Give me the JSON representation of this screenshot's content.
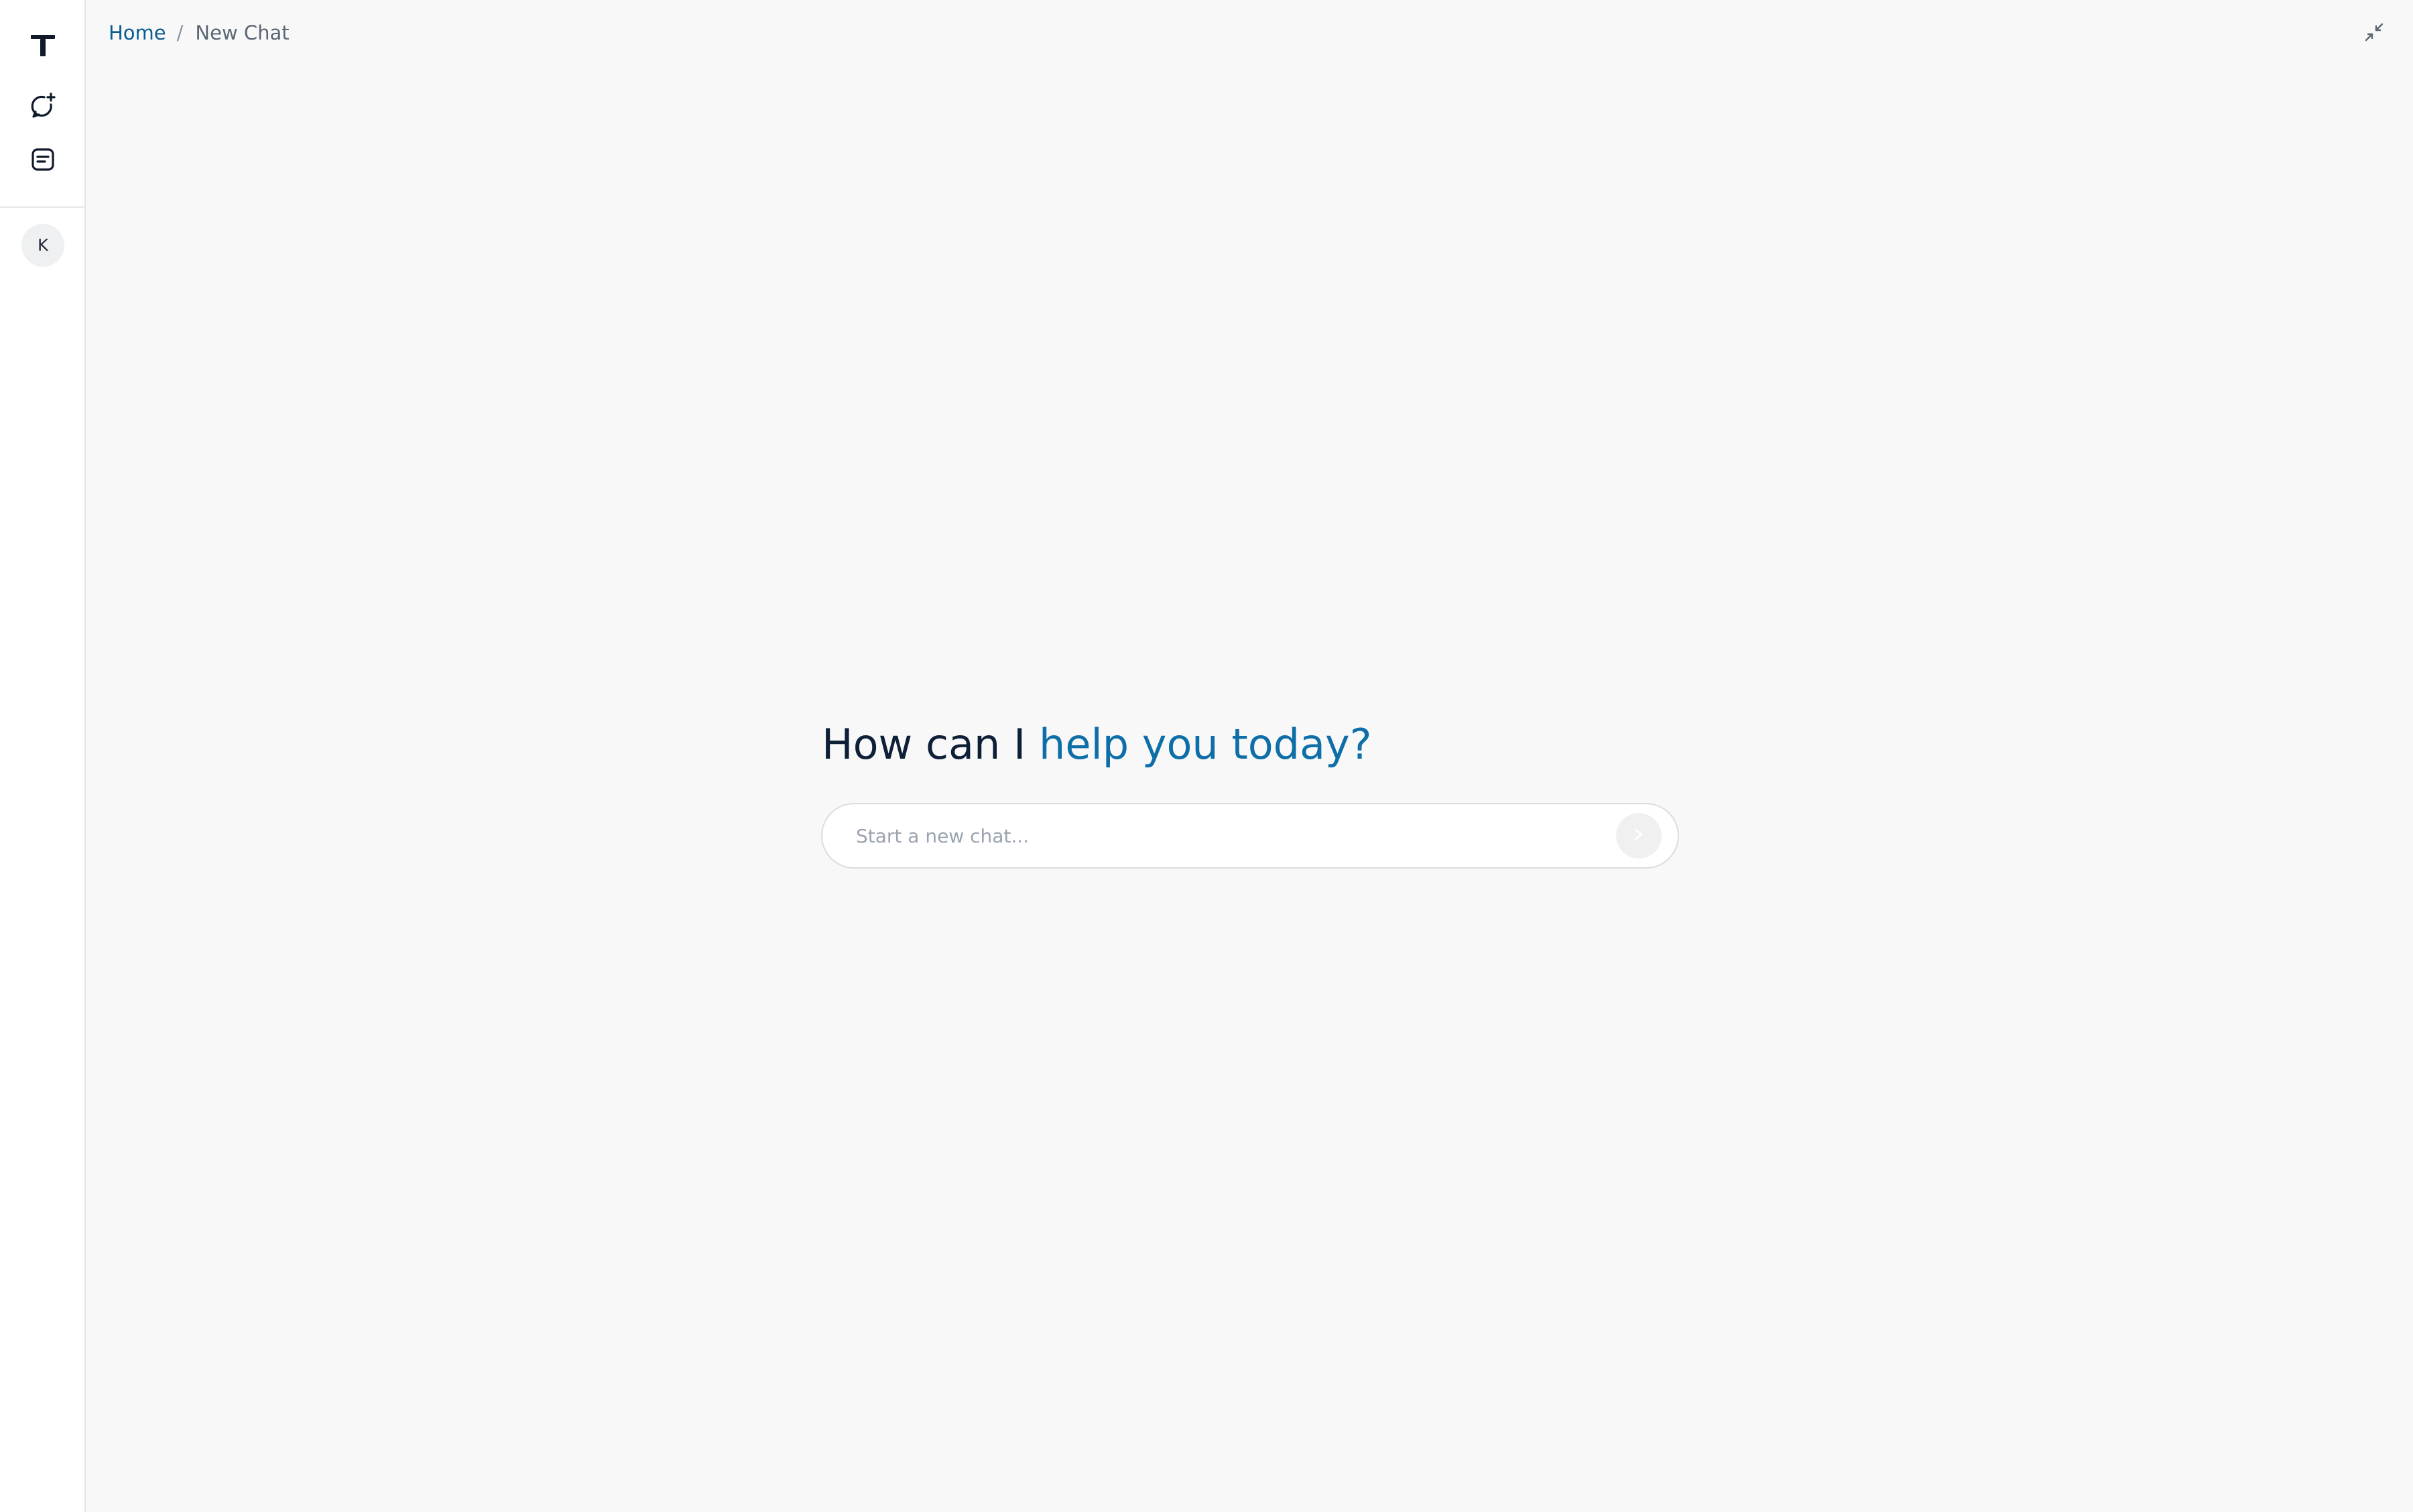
{
  "sidebar": {
    "logo_icon": "brand-t-icon",
    "new_chat_icon": "chat-plus-icon",
    "chats_icon": "chat-list-icon",
    "avatar_initial": "K"
  },
  "breadcrumb": {
    "home": "Home",
    "separator": "/",
    "current": "New Chat"
  },
  "header": {
    "collapse_icon": "collapse-arrows-icon"
  },
  "hero": {
    "title_part1": "How can I ",
    "title_part2": "help you today?"
  },
  "chat": {
    "placeholder": "Start a new chat...",
    "value": "",
    "send_icon": "send-arrow-icon"
  },
  "colors": {
    "brand_blue": "#0d6ea8",
    "breadcrumb_link": "#0b5c93",
    "title_dark": "#0e1f38",
    "background": "#f8f8f8"
  }
}
